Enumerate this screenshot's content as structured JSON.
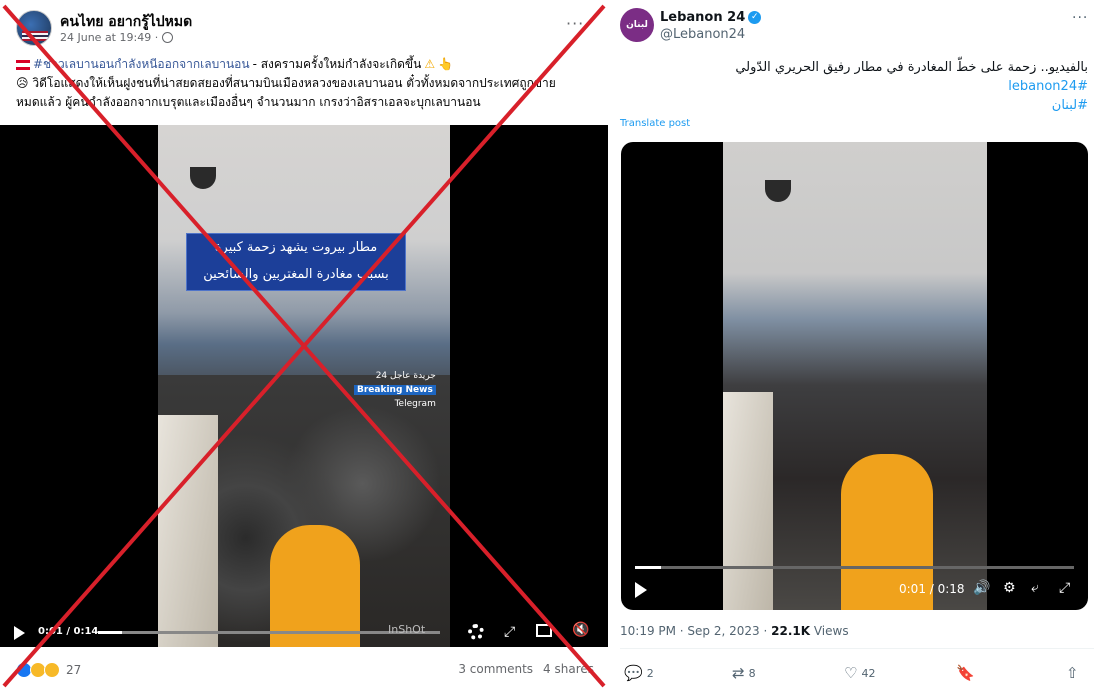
{
  "facebook": {
    "author": "คนไทย อยากรู้ไปหมด",
    "time": "24 June at 19:49 ·",
    "text_line1_hashtag": "#ชาวเลบานอนกำลังหนีออกจากเลบานอน",
    "text_line1_rest": "- สงครามครั้งใหม่กำลังจะเกิดขึ้น",
    "text_line2": "วิดีโอแสดงให้เห็นฝูงชนที่น่าสยดสยองที่สนามบินเมืองหลวงของเลบานอน ตั๋วทั้งหมดจากประเทศถูกขาย",
    "text_line3": "หมดแล้ว ผู้คนกำลังออกจากเบรุตและเมืองอื่นๆ จำนวนมาก เกรงว่าอิสราเอลจะบุกเลบานอน",
    "video_caption_line1": "مطار بيروت يشهد زحمة كبيرة",
    "video_caption_line2": "بسبب مغادرة المغتربين والسائحين",
    "news_badge_line1": "جريدة عاجل 24",
    "news_badge_line2": "Breaking News",
    "news_badge_line3": "Telegram",
    "video_brand": "InShOt",
    "video_timecode": "0:01 / 0:14",
    "video_progress": 0.07,
    "reaction_count": "27",
    "comments": "3 comments",
    "shares": "4 shares",
    "colors": {
      "x_mark": "#d8202a",
      "hashtag": "#385898"
    }
  },
  "twitter": {
    "display_name": "Lebanon 24",
    "handle": "@Lebanon24",
    "avatar_text": "لبنان",
    "text_line1": "بالفيديو.. زحمة على خطّ المغادرة في مطار رفيق الحريري الدّولي",
    "hashtag1": "#lebanon24",
    "hashtag2": "#لبنان",
    "translate_label": "Translate post",
    "video_timecode": "0:01 / 0:18",
    "video_progress": 0.06,
    "meta_time": "10:19 PM · Sep 2, 2023 ·",
    "views_count": "22.1K",
    "views_label": "Views",
    "replies": "2",
    "reposts": "8",
    "likes": "42",
    "colors": {
      "accent": "#1d9bf0"
    }
  }
}
